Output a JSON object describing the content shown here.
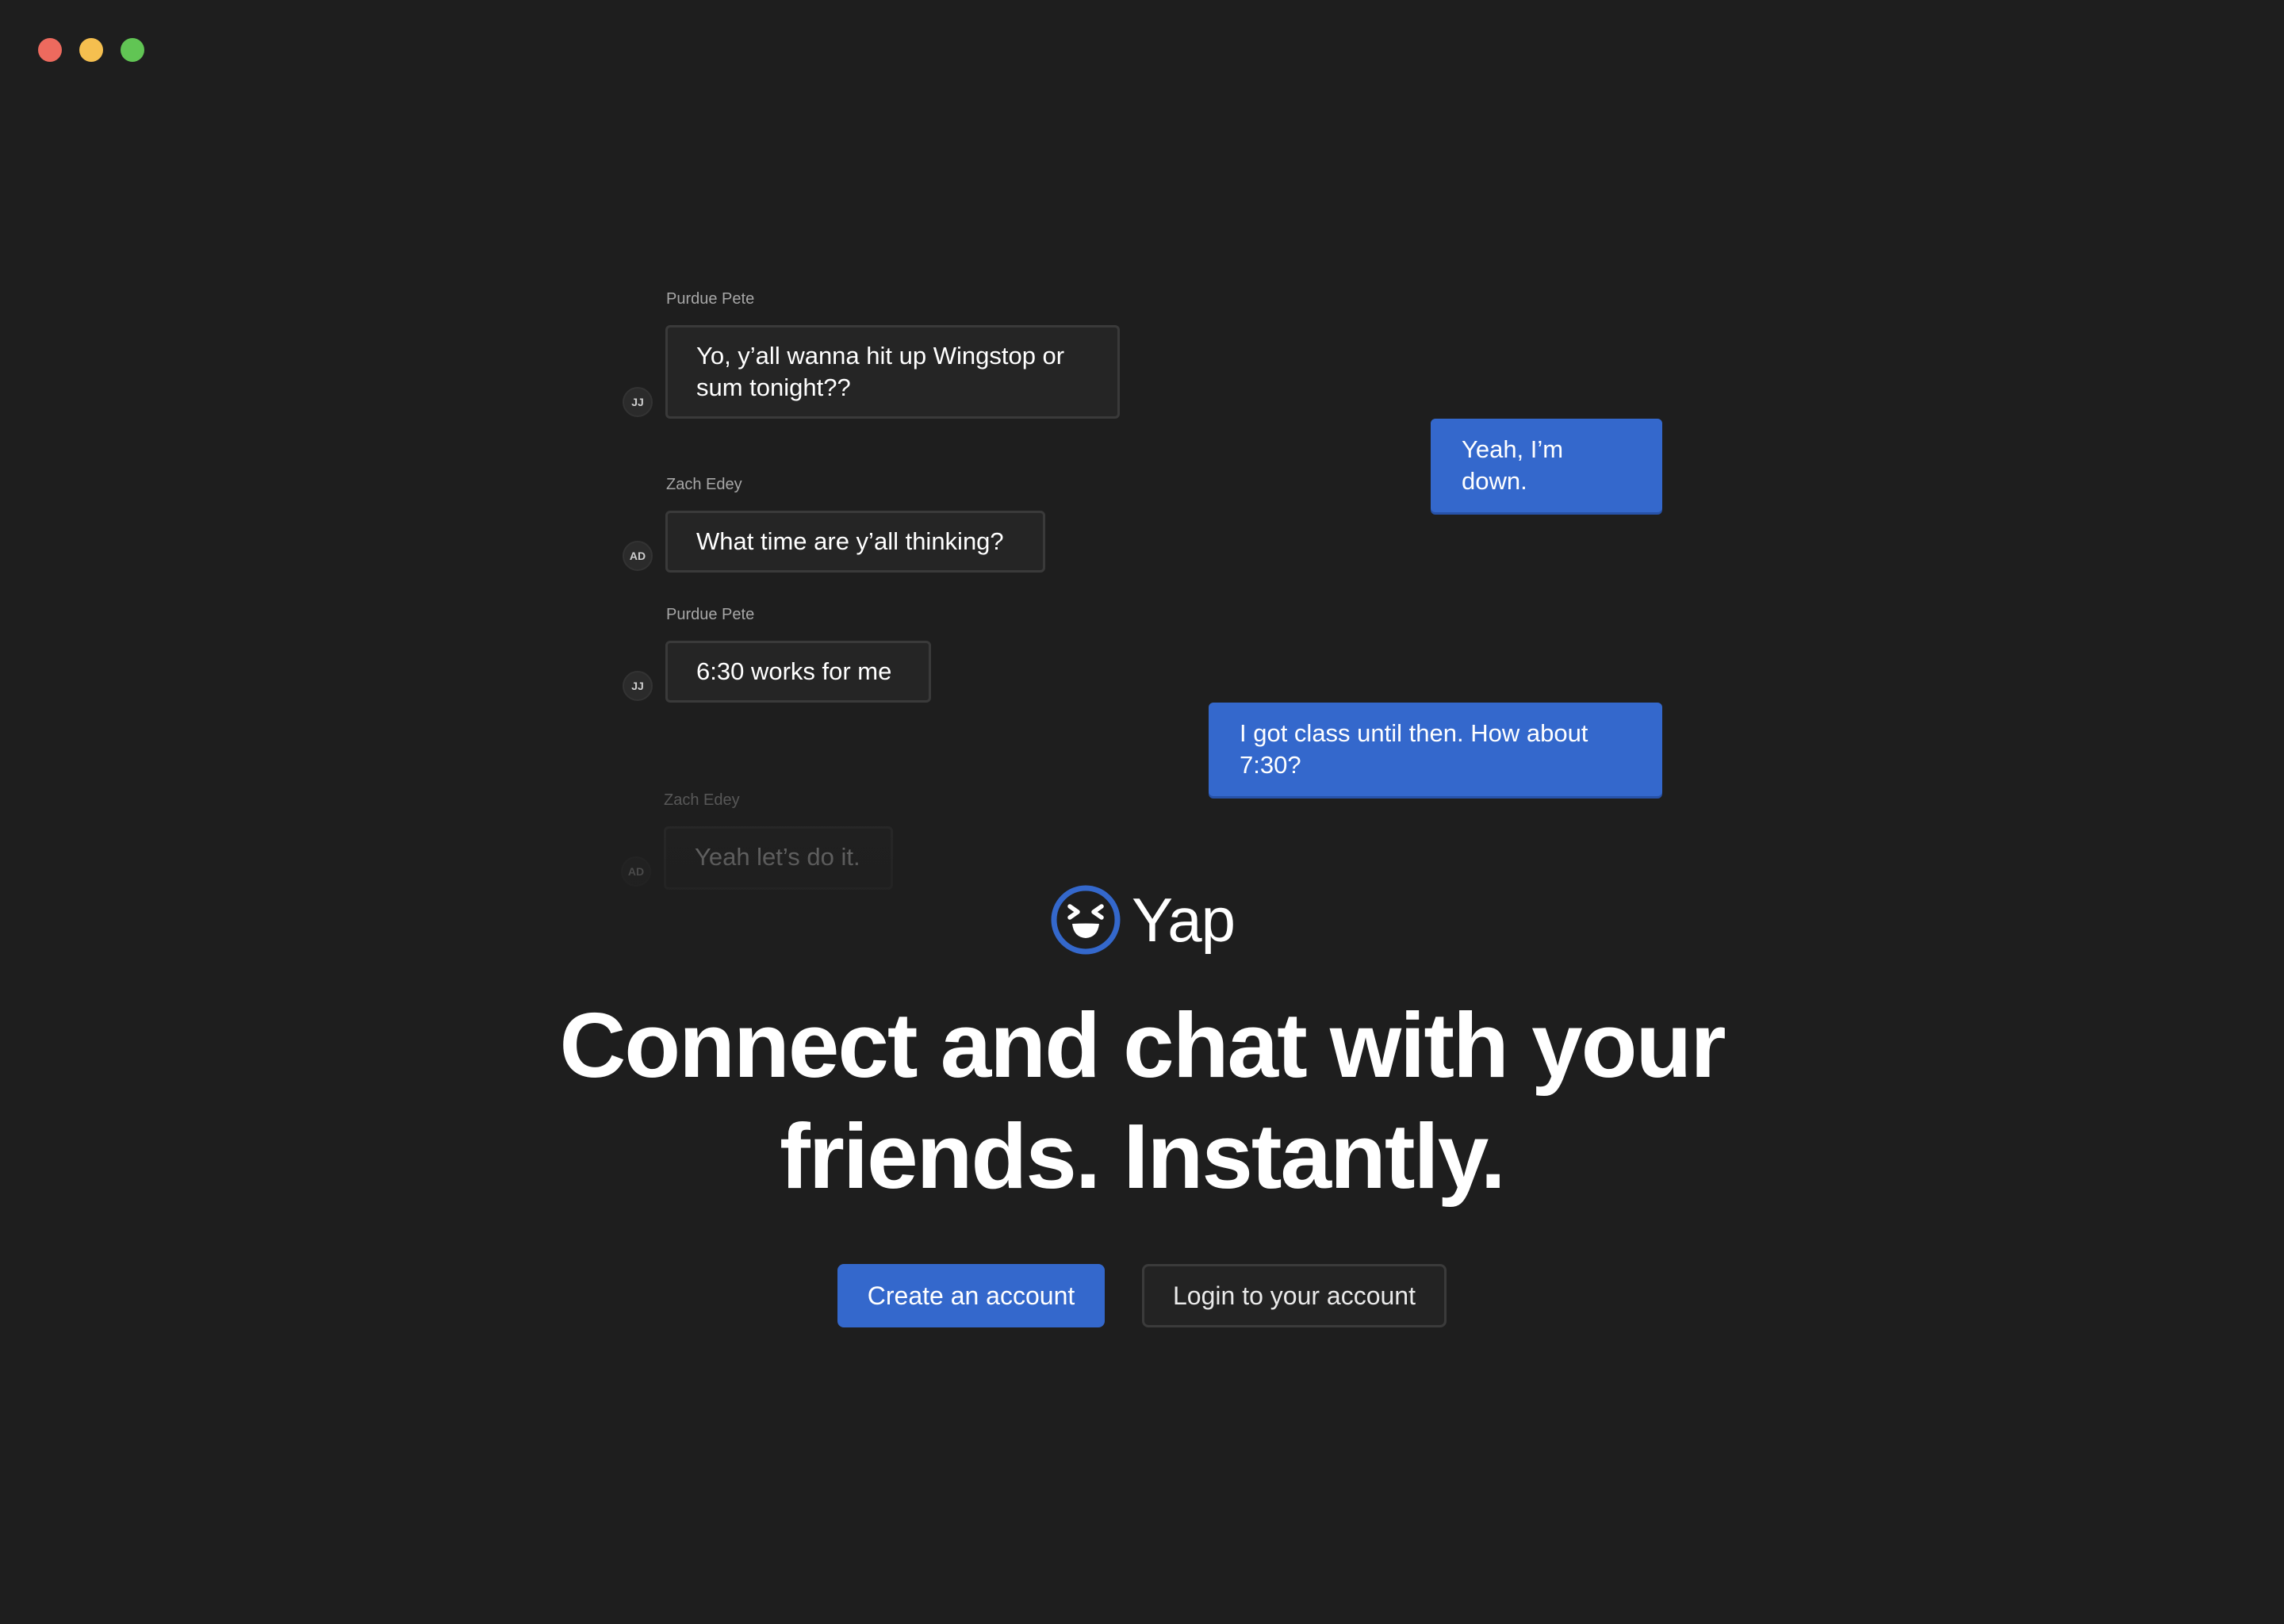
{
  "window": {
    "controls": [
      "close",
      "minimize",
      "maximize"
    ]
  },
  "chat": {
    "messages": [
      {
        "sender": "Purdue Pete",
        "avatar": "JJ",
        "text_lines": [
          "Yo, y’all wanna hit up Wingstop or",
          "sum tonight??"
        ],
        "outgoing": false
      },
      {
        "sender": "",
        "avatar": "",
        "text_lines": [
          "Yeah, I’m down."
        ],
        "outgoing": true
      },
      {
        "sender": "Zach Edey",
        "avatar": "AD",
        "text_lines": [
          "What time are y’all thinking?"
        ],
        "outgoing": false
      },
      {
        "sender": "Purdue Pete",
        "avatar": "JJ",
        "text_lines": [
          "6:30 works for me"
        ],
        "outgoing": false
      },
      {
        "sender": "",
        "avatar": "",
        "text_lines": [
          "I got class until then. How about",
          "7:30?"
        ],
        "outgoing": true
      },
      {
        "sender": "Zach Edey",
        "avatar": "AD",
        "text_lines": [
          "Yeah let’s do it."
        ],
        "outgoing": false
      }
    ]
  },
  "brand": {
    "name": "Yap",
    "logo_icon": "laughing-face-icon",
    "accent": "#3468cc"
  },
  "hero": {
    "headline_line1": "Connect and chat with your",
    "headline_line2": "friends. Instantly."
  },
  "actions": {
    "create_label": "Create an account",
    "login_label": "Login to your account"
  },
  "colors": {
    "background": "#1e1e1e",
    "incoming_bubble": "#252525",
    "outgoing_bubble": "#3468cc"
  }
}
